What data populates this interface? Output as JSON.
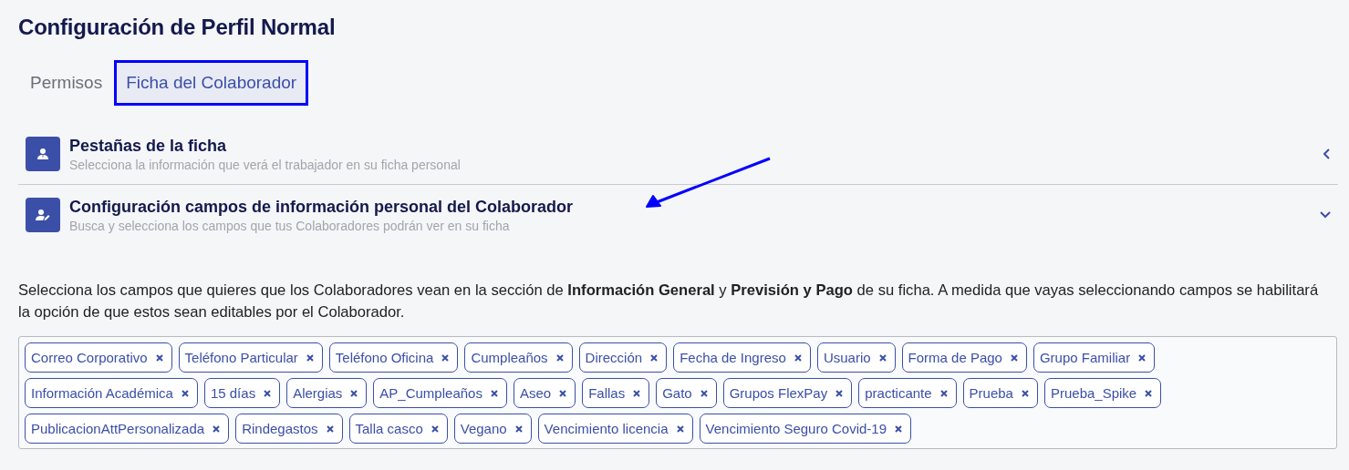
{
  "title": "Configuración de Perfil Normal",
  "tabs": [
    {
      "label": "Permisos",
      "selected": false
    },
    {
      "label": "Ficha del Colaborador",
      "selected": true
    }
  ],
  "sections": [
    {
      "kind": "person",
      "title": "Pestañas de la ficha",
      "subtitle": "Selecciona la información que verá el trabajador en su ficha personal",
      "expanded": false
    },
    {
      "kind": "person-edit",
      "title": "Configuración campos de información personal del Colaborador",
      "subtitle": "Busca y selecciona los campos que tus Colaboradores podrán ver en su ficha",
      "expanded": true
    }
  ],
  "description": "Selecciona los campos que quieres que los Colaboradores vean en la sección de **Información General** y **Previsión y Pago** de su ficha. A medida que vayas seleccionando campos se habilitará la opción de que estos sean editables por el Colaborador.",
  "selected_fields": [
    [
      "Correo Corporativo",
      "Teléfono Particular",
      "Teléfono Oficina",
      "Cumpleaños",
      "Dirección",
      "Fecha de Ingreso",
      "Usuario",
      "Forma de Pago",
      "Grupo Familiar"
    ],
    [
      "Información Académica",
      "15 días",
      "Alergias",
      "AP_Cumpleaños",
      "Aseo",
      "Fallas",
      "Gato",
      "Grupos FlexPay",
      "practicante",
      "Prueba",
      "Prueba_Spike"
    ],
    [
      "PublicacionAttPersonalizada",
      "Rindegastos",
      "Talla casco",
      "Vegano",
      "Vencimiento licencia",
      "Vencimiento Seguro Covid-19"
    ]
  ]
}
